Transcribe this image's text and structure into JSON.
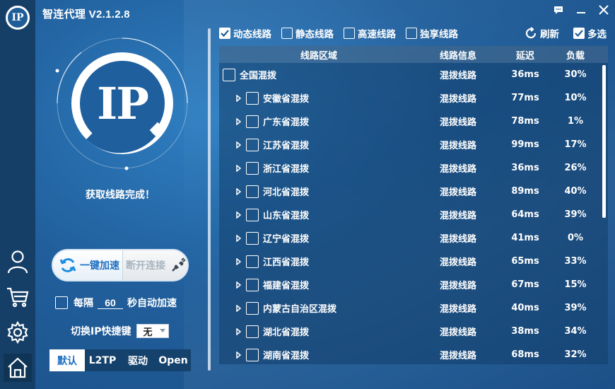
{
  "window": {
    "title": "智连代理 V2.1.2.8",
    "logo_text": "IP"
  },
  "sidebar": {
    "items": [
      {
        "name": "user",
        "icon": "user-icon"
      },
      {
        "name": "cart",
        "icon": "cart-icon"
      },
      {
        "name": "settings",
        "icon": "gear-icon"
      },
      {
        "name": "home",
        "icon": "home-icon",
        "active": true
      }
    ]
  },
  "left_panel": {
    "logo_text": "IP",
    "status": "获取线路完成！",
    "accelerate_label": "一键加速",
    "disconnect_label": "断开连接",
    "auto_prefix": "每隔",
    "auto_interval": "60",
    "auto_suffix": "秒自动加速",
    "hotkey_label": "切换IP快捷键",
    "hotkey_value": "无",
    "modes": [
      "默认",
      "L2TP",
      "驱动",
      "Open"
    ],
    "active_mode": "默认"
  },
  "filters": [
    {
      "label": "动态线路",
      "checked": true
    },
    {
      "label": "静态线路",
      "checked": false
    },
    {
      "label": "高速线路",
      "checked": false
    },
    {
      "label": "独享线路",
      "checked": false
    }
  ],
  "toolbar": {
    "refresh_label": "刷新",
    "multi_label": "多选",
    "multi_checked": true
  },
  "table": {
    "headers": {
      "region": "线路区域",
      "info": "线路信息",
      "latency": "延迟",
      "load": "负载"
    },
    "rows": [
      {
        "region": "全国混拨",
        "info": "混拨线路",
        "latency": "36ms",
        "load": "30%",
        "top": true
      },
      {
        "region": "安徽省混拨",
        "info": "混拨线路",
        "latency": "77ms",
        "load": "10%"
      },
      {
        "region": "广东省混拨",
        "info": "混拨线路",
        "latency": "78ms",
        "load": "1%"
      },
      {
        "region": "江苏省混拨",
        "info": "混拨线路",
        "latency": "99ms",
        "load": "17%"
      },
      {
        "region": "浙江省混拨",
        "info": "混拨线路",
        "latency": "36ms",
        "load": "26%"
      },
      {
        "region": "河北省混拨",
        "info": "混拨线路",
        "latency": "89ms",
        "load": "40%"
      },
      {
        "region": "山东省混拨",
        "info": "混拨线路",
        "latency": "64ms",
        "load": "39%"
      },
      {
        "region": "辽宁省混拨",
        "info": "混拨线路",
        "latency": "41ms",
        "load": "0%"
      },
      {
        "region": "江西省混拨",
        "info": "混拨线路",
        "latency": "65ms",
        "load": "33%"
      },
      {
        "region": "福建省混拨",
        "info": "混拨线路",
        "latency": "67ms",
        "load": "15%"
      },
      {
        "region": "内蒙古自治区混拨",
        "info": "混拨线路",
        "latency": "40ms",
        "load": "39%"
      },
      {
        "region": "湖北省混拨",
        "info": "混拨线路",
        "latency": "38ms",
        "load": "34%"
      },
      {
        "region": "湖南省混拨",
        "info": "混拨线路",
        "latency": "68ms",
        "load": "32%"
      }
    ]
  },
  "colors": {
    "background": "#215f9c",
    "rail": "#163f68",
    "accent": "#1e6fc0"
  }
}
